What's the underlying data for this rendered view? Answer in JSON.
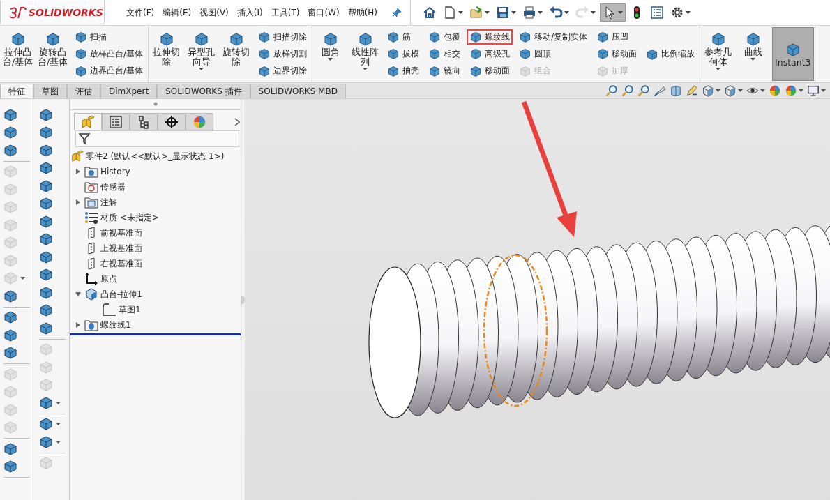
{
  "app": {
    "logo": "SOLIDWORKS"
  },
  "menu": [
    "文件(F)",
    "编辑(E)",
    "视图(V)",
    "插入(I)",
    "工具(T)",
    "窗口(W)",
    "帮助(H)"
  ],
  "quick_tools": [
    {
      "kind": "home",
      "dropdown": false,
      "disabled": false,
      "selected": false
    },
    {
      "kind": "new",
      "dropdown": true,
      "disabled": false,
      "selected": false
    },
    {
      "kind": "open",
      "dropdown": true,
      "disabled": false,
      "selected": false
    },
    {
      "kind": "save",
      "dropdown": true,
      "disabled": false,
      "selected": false
    },
    {
      "kind": "print",
      "dropdown": true,
      "disabled": false,
      "selected": false
    },
    {
      "kind": "undo",
      "dropdown": true,
      "disabled": false,
      "selected": false
    },
    {
      "kind": "redo",
      "dropdown": true,
      "disabled": true,
      "selected": false
    },
    {
      "kind": "select",
      "dropdown": true,
      "disabled": false,
      "selected": true
    },
    {
      "kind": "traffic",
      "dropdown": false,
      "disabled": false,
      "selected": false
    },
    {
      "kind": "list",
      "dropdown": false,
      "disabled": false,
      "selected": false
    },
    {
      "kind": "gear",
      "dropdown": true,
      "disabled": false,
      "selected": false
    }
  ],
  "ribbon": {
    "groups": [
      {
        "blocks": [
          {
            "kind": "large",
            "label": "拉伸凸台/基体",
            "dropdown": false,
            "selected": false
          },
          {
            "kind": "large",
            "label": "旋转凸台/基体",
            "dropdown": false,
            "selected": false
          },
          {
            "kind": "stack",
            "items": [
              {
                "label": "扫描",
                "disabled": false,
                "highlighted": false
              },
              {
                "label": "放样凸台/基体",
                "disabled": false,
                "highlighted": false
              },
              {
                "label": "边界凸台/基体",
                "disabled": false,
                "highlighted": false
              }
            ]
          }
        ]
      },
      {
        "blocks": [
          {
            "kind": "large",
            "label": "拉伸切除",
            "dropdown": false,
            "selected": false
          },
          {
            "kind": "large",
            "label": "异型孔向导",
            "dropdown": true,
            "selected": false
          },
          {
            "kind": "large",
            "label": "旋转切除",
            "dropdown": false,
            "selected": false
          },
          {
            "kind": "stack",
            "items": [
              {
                "label": "扫描切除",
                "disabled": false,
                "highlighted": false
              },
              {
                "label": "放样切割",
                "disabled": false,
                "highlighted": false
              },
              {
                "label": "边界切除",
                "disabled": false,
                "highlighted": false
              }
            ]
          }
        ]
      },
      {
        "blocks": [
          {
            "kind": "large",
            "label": "圆角",
            "dropdown": true,
            "selected": false
          },
          {
            "kind": "large",
            "label": "线性阵列",
            "dropdown": true,
            "selected": false
          },
          {
            "kind": "stack",
            "items": [
              {
                "label": "筋",
                "disabled": false,
                "highlighted": false
              },
              {
                "label": "拔模",
                "disabled": false,
                "highlighted": false
              },
              {
                "label": "抽壳",
                "disabled": false,
                "highlighted": false
              }
            ]
          },
          {
            "kind": "stack",
            "items": [
              {
                "label": "包覆",
                "disabled": false,
                "highlighted": false
              },
              {
                "label": "相交",
                "disabled": false,
                "highlighted": false
              },
              {
                "label": "镜向",
                "disabled": false,
                "highlighted": false
              }
            ]
          },
          {
            "kind": "stack",
            "items": [
              {
                "label": "螺纹线",
                "disabled": false,
                "highlighted": true
              },
              {
                "label": "高级孔",
                "disabled": false,
                "highlighted": false
              },
              {
                "label": "移动面",
                "disabled": false,
                "highlighted": false
              }
            ]
          },
          {
            "kind": "stack",
            "items": [
              {
                "label": "移动/复制实体",
                "disabled": false,
                "highlighted": false
              },
              {
                "label": "圆顶",
                "disabled": false,
                "highlighted": false
              },
              {
                "label": "组合",
                "disabled": true,
                "highlighted": false
              }
            ]
          },
          {
            "kind": "stack",
            "items": [
              {
                "label": "压凹",
                "disabled": false,
                "highlighted": false
              },
              {
                "label": "移动面",
                "disabled": false,
                "highlighted": false
              },
              {
                "label": "加厚",
                "disabled": true,
                "highlighted": false
              }
            ]
          },
          {
            "kind": "stack",
            "items": [
              {
                "label": "比例缩放",
                "disabled": false,
                "highlighted": false
              }
            ]
          }
        ]
      },
      {
        "blocks": [
          {
            "kind": "large",
            "label": "参考几何体",
            "dropdown": true,
            "selected": false
          },
          {
            "kind": "large",
            "label": "曲线",
            "dropdown": true,
            "selected": false
          }
        ]
      },
      {
        "blocks": [
          {
            "kind": "large",
            "label": "Instant3",
            "dropdown": false,
            "selected": true
          }
        ]
      }
    ]
  },
  "tabs": [
    {
      "label": "特征",
      "selected": true
    },
    {
      "label": "草图",
      "selected": false
    },
    {
      "label": "评估",
      "selected": false
    },
    {
      "label": "DimXpert",
      "selected": false
    },
    {
      "label": "SOLIDWORKS 插件",
      "selected": false
    },
    {
      "label": "SOLIDWORKS MBD",
      "selected": false
    }
  ],
  "view_tools": [
    {
      "kind": "magnifier",
      "dropdown": false
    },
    {
      "kind": "magnifier",
      "dropdown": false
    },
    {
      "kind": "magnifier",
      "dropdown": false
    },
    {
      "kind": "fan",
      "dropdown": false
    },
    {
      "kind": "section",
      "dropdown": false
    },
    {
      "kind": "pencil",
      "dropdown": false
    },
    {
      "kind": "cube",
      "dropdown": true
    },
    {
      "kind": "cube",
      "dropdown": true
    },
    {
      "kind": "eye",
      "dropdown": true
    },
    {
      "kind": "sphere",
      "dropdown": false
    },
    {
      "kind": "sphere",
      "dropdown": true
    },
    {
      "kind": "monitor",
      "dropdown": true
    }
  ],
  "left_tools": [
    {
      "kind": "tool",
      "disabled": false,
      "dropdown": false
    },
    {
      "kind": "tool",
      "disabled": false,
      "dropdown": false
    },
    {
      "kind": "tool",
      "disabled": false,
      "dropdown": false
    },
    {
      "kind": "separator"
    },
    {
      "kind": "tool",
      "disabled": true,
      "dropdown": false
    },
    {
      "kind": "tool",
      "disabled": true,
      "dropdown": false
    },
    {
      "kind": "tool",
      "disabled": true,
      "dropdown": false
    },
    {
      "kind": "tool",
      "disabled": true,
      "dropdown": false
    },
    {
      "kind": "tool",
      "disabled": true,
      "dropdown": false
    },
    {
      "kind": "tool",
      "disabled": true,
      "dropdown": false
    },
    {
      "kind": "tool",
      "disabled": true,
      "dropdown": true
    },
    {
      "kind": "tool",
      "disabled": false,
      "dropdown": false
    },
    {
      "kind": "separator"
    },
    {
      "kind": "tool",
      "disabled": false,
      "dropdown": false
    },
    {
      "kind": "tool",
      "disabled": false,
      "dropdown": false
    },
    {
      "kind": "tool",
      "disabled": false,
      "dropdown": false
    },
    {
      "kind": "separator"
    },
    {
      "kind": "tool",
      "disabled": true,
      "dropdown": false
    },
    {
      "kind": "tool",
      "disabled": true,
      "dropdown": false
    },
    {
      "kind": "tool",
      "disabled": true,
      "dropdown": false
    },
    {
      "kind": "tool",
      "disabled": true,
      "dropdown": false
    },
    {
      "kind": "separator"
    },
    {
      "kind": "tool",
      "disabled": false,
      "dropdown": false
    },
    {
      "kind": "tool",
      "disabled": false,
      "dropdown": false
    },
    {
      "kind": "separator"
    }
  ],
  "left_tools_2": [
    {
      "kind": "tool",
      "disabled": false,
      "dropdown": false
    },
    {
      "kind": "tool",
      "disabled": false,
      "dropdown": false
    },
    {
      "kind": "tool",
      "disabled": false,
      "dropdown": false
    },
    {
      "kind": "tool",
      "disabled": false,
      "dropdown": false
    },
    {
      "kind": "tool",
      "disabled": false,
      "dropdown": false
    },
    {
      "kind": "tool",
      "disabled": false,
      "dropdown": false
    },
    {
      "kind": "tool",
      "disabled": false,
      "dropdown": false
    },
    {
      "kind": "tool",
      "disabled": false,
      "dropdown": false
    },
    {
      "kind": "tool",
      "disabled": false,
      "dropdown": false
    },
    {
      "kind": "tool",
      "disabled": false,
      "dropdown": false
    },
    {
      "kind": "tool",
      "disabled": false,
      "dropdown": false
    },
    {
      "kind": "tool",
      "disabled": false,
      "dropdown": false
    },
    {
      "kind": "tool",
      "disabled": false,
      "dropdown": false
    },
    {
      "kind": "separator"
    },
    {
      "kind": "tool",
      "disabled": true,
      "dropdown": false
    },
    {
      "kind": "tool",
      "disabled": true,
      "dropdown": false
    },
    {
      "kind": "tool",
      "disabled": true,
      "dropdown": false
    },
    {
      "kind": "tool",
      "disabled": false,
      "dropdown": true
    },
    {
      "kind": "separator"
    },
    {
      "kind": "tool",
      "disabled": false,
      "dropdown": true
    },
    {
      "kind": "tool",
      "disabled": false,
      "dropdown": true
    },
    {
      "kind": "separator"
    },
    {
      "kind": "tool",
      "disabled": true,
      "dropdown": false
    }
  ],
  "feature_manager": {
    "tabs": [
      {
        "kind": "part",
        "selected": true
      },
      {
        "kind": "list",
        "selected": false
      },
      {
        "kind": "config",
        "selected": false
      },
      {
        "kind": "target",
        "selected": false
      },
      {
        "kind": "sphere",
        "selected": false
      }
    ],
    "root": {
      "kind": "part",
      "label": "零件2 (默认<<默认>_显示状态 1>)"
    },
    "tree": [
      {
        "kind": "folder",
        "label": "History",
        "expanded": false
      },
      {
        "kind": "sensor",
        "label": "传感器"
      },
      {
        "kind": "annotation",
        "label": "注解",
        "expanded": false
      },
      {
        "kind": "material",
        "label": "材质 <未指定>"
      },
      {
        "kind": "plane",
        "label": "前视基准面"
      },
      {
        "kind": "plane",
        "label": "上视基准面"
      },
      {
        "kind": "plane",
        "label": "右视基准面"
      },
      {
        "kind": "origin",
        "label": "原点"
      },
      {
        "kind": "feature",
        "label": "凸台-拉伸1",
        "expanded": true,
        "children": [
          {
            "kind": "sketch",
            "label": "草图1"
          }
        ]
      },
      {
        "kind": "thread",
        "label": "螺纹线1",
        "expanded": false
      }
    ]
  }
}
